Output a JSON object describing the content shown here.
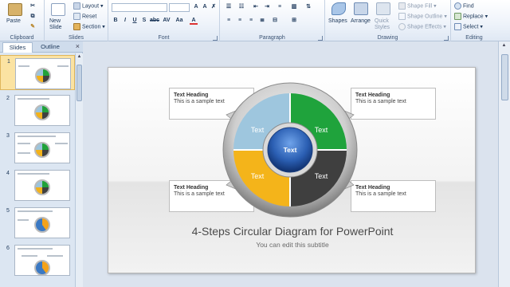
{
  "ribbon": {
    "clipboard": {
      "label": "Clipboard",
      "paste": "Paste"
    },
    "slides": {
      "label": "Slides",
      "new_slide": "New Slide",
      "layout": "Layout",
      "reset": "Reset",
      "section": "Section"
    },
    "font": {
      "label": "Font"
    },
    "paragraph": {
      "label": "Paragraph"
    },
    "drawing": {
      "label": "Drawing",
      "shapes": "Shapes",
      "arrange": "Arrange",
      "quick_styles": "Quick Styles",
      "shape_fill": "Shape Fill",
      "shape_outline": "Shape Outline",
      "shape_effects": "Shape Effects"
    },
    "editing": {
      "label": "Editing",
      "find": "Find",
      "replace": "Replace",
      "select": "Select"
    }
  },
  "panel": {
    "tabs": [
      "Slides",
      "Outline"
    ],
    "close": "×",
    "thumbnails": [
      {
        "number": "1",
        "selected": true
      },
      {
        "number": "2",
        "selected": false
      },
      {
        "number": "3",
        "selected": false
      },
      {
        "number": "4",
        "selected": false
      },
      {
        "number": "5",
        "selected": false
      },
      {
        "number": "6",
        "selected": false
      }
    ]
  },
  "slide": {
    "segments": {
      "top_left": "Text",
      "top_right": "Text",
      "bottom_left": "Text",
      "bottom_right": "Text",
      "center": "Text"
    },
    "callouts": [
      {
        "heading": "Text Heading",
        "body": "This is a sample text"
      },
      {
        "heading": "Text Heading",
        "body": "This is a sample text"
      },
      {
        "heading": "Text Heading",
        "body": "This is a sample text"
      },
      {
        "heading": "Text Heading",
        "body": "This is a sample text"
      }
    ],
    "title": "4-Steps Circular Diagram for PowerPoint",
    "subtitle": "You can edit this subtitle"
  },
  "colors": {
    "segment_top_left": "#9ec6de",
    "segment_top_right": "#1fa33c",
    "segment_bottom_left": "#f4b41a",
    "segment_bottom_right": "#3f3f3f",
    "center": "#2b5fb3"
  }
}
